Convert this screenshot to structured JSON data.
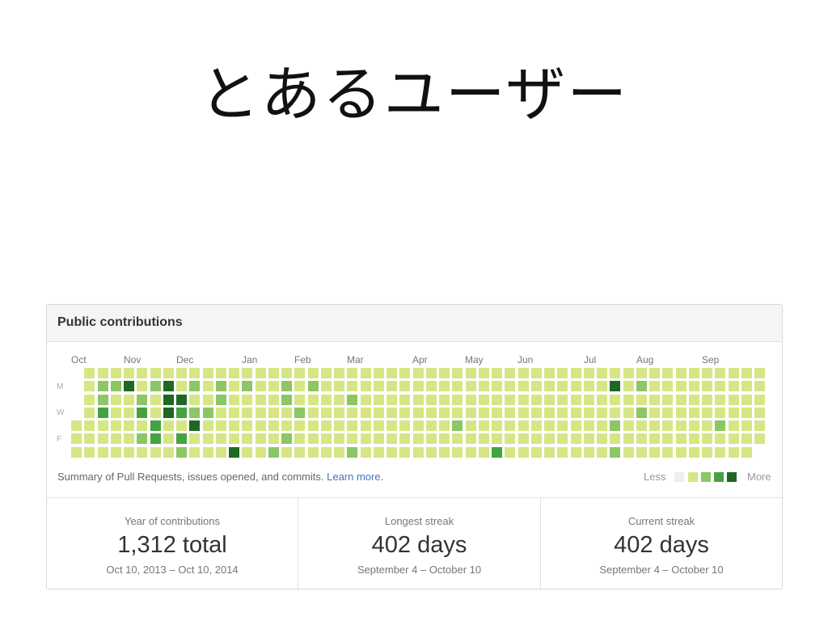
{
  "slide_title": "とあるユーザー",
  "panel": {
    "title": "Public contributions",
    "months": [
      "Oct",
      "Nov",
      "Dec",
      "Jan",
      "Feb",
      "Mar",
      "Apr",
      "May",
      "Jun",
      "Jul",
      "Aug",
      "Sep"
    ],
    "days": [
      "M",
      "W",
      "F"
    ],
    "summary_text": "Summary of Pull Requests, issues opened, and commits.",
    "learn_more": "Learn more",
    "summary_end": ".",
    "legend_less": "Less",
    "legend_more": "More",
    "colors": [
      "#eeeeee",
      "#d6e685",
      "#8cc665",
      "#44a340",
      "#1e6823"
    ],
    "calendar": {
      "weeks": 53,
      "first_week_start_day": 4,
      "last_week_end_day": 5,
      "default_level": 1,
      "nonzero_cells": [
        [
          2,
          1,
          2
        ],
        [
          3,
          1,
          2
        ],
        [
          4,
          1,
          4
        ],
        [
          6,
          1,
          2
        ],
        [
          7,
          1,
          4
        ],
        [
          9,
          1,
          2
        ],
        [
          11,
          1,
          2
        ],
        [
          13,
          1,
          2
        ],
        [
          16,
          1,
          2
        ],
        [
          18,
          1,
          2
        ],
        [
          41,
          1,
          4
        ],
        [
          43,
          1,
          2
        ],
        [
          2,
          2,
          2
        ],
        [
          5,
          2,
          2
        ],
        [
          7,
          2,
          4
        ],
        [
          8,
          2,
          4
        ],
        [
          11,
          2,
          2
        ],
        [
          16,
          2,
          2
        ],
        [
          21,
          2,
          2
        ],
        [
          2,
          3,
          3
        ],
        [
          5,
          3,
          3
        ],
        [
          7,
          3,
          4
        ],
        [
          8,
          3,
          3
        ],
        [
          9,
          3,
          2
        ],
        [
          10,
          3,
          2
        ],
        [
          17,
          3,
          2
        ],
        [
          43,
          3,
          2
        ],
        [
          6,
          4,
          3
        ],
        [
          9,
          4,
          4
        ],
        [
          29,
          4,
          2
        ],
        [
          41,
          4,
          2
        ],
        [
          49,
          4,
          2
        ],
        [
          5,
          5,
          2
        ],
        [
          6,
          5,
          3
        ],
        [
          8,
          5,
          3
        ],
        [
          16,
          5,
          2
        ],
        [
          8,
          6,
          2
        ],
        [
          12,
          6,
          4
        ],
        [
          15,
          6,
          2
        ],
        [
          21,
          6,
          2
        ],
        [
          32,
          6,
          3
        ],
        [
          41,
          6,
          2
        ],
        [
          3,
          7,
          2
        ],
        [
          7,
          7,
          3
        ],
        [
          8,
          7,
          2
        ],
        [
          11,
          7,
          2
        ],
        [
          12,
          7,
          2
        ],
        [
          15,
          7,
          2
        ],
        [
          21,
          7,
          2
        ],
        [
          26,
          7,
          2
        ],
        [
          32,
          7,
          3
        ],
        [
          40,
          7,
          2
        ]
      ]
    }
  },
  "stats": [
    {
      "label": "Year of contributions",
      "value": "1,312 total",
      "range": "Oct 10, 2013 – Oct 10, 2014"
    },
    {
      "label": "Longest streak",
      "value": "402 days",
      "range": "September 4 – October 10"
    },
    {
      "label": "Current streak",
      "value": "402 days",
      "range": "September 4 – October 10"
    }
  ]
}
